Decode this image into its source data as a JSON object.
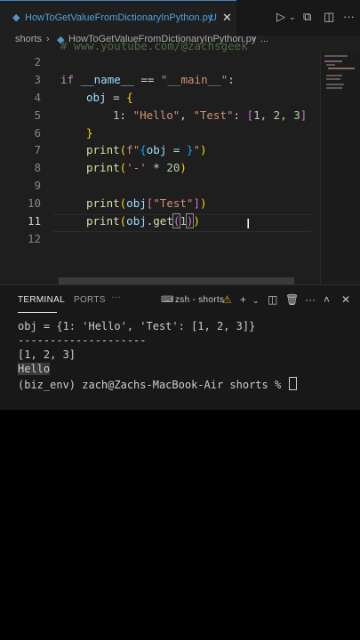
{
  "tab": {
    "filename": "HowToGetValueFromDictionaryInPython.py",
    "status": "U",
    "close": "✕"
  },
  "breadcrumb": {
    "folder": "shorts",
    "file": "HowToGetValueFromDictionaryInPython.py",
    "more": "..."
  },
  "editor": {
    "top_comment": "# www.youtube.com/@zachsgeek",
    "lines": [
      {
        "number": "2"
      },
      {
        "number": "3",
        "p1": "if",
        "p2": " __name__ ",
        "p3": "==",
        "p4": " \"__main__\"",
        "p5": ":"
      },
      {
        "number": "4",
        "p1": "obj",
        "p2": " = ",
        "p3": "{"
      },
      {
        "number": "5",
        "p1": "1",
        "p2": ": ",
        "p3": "\"Hello\"",
        "p4": ", ",
        "p5": "\"Test\"",
        "p6": ": ",
        "p7": "[",
        "p8": "1, 2, 3",
        "p9": "]"
      },
      {
        "number": "6",
        "p1": "}"
      },
      {
        "number": "7",
        "p1": "print",
        "p2": "(",
        "p3": "f\"",
        "p4": "{",
        "p5": "obj = ",
        "p6": "}",
        "p7": "\"",
        "p8": ")"
      },
      {
        "number": "8",
        "p1": "print",
        "p2": "(",
        "p3": "'-'",
        "p4": " * ",
        "p5": "20",
        "p6": ")"
      },
      {
        "number": "9"
      },
      {
        "number": "10",
        "p1": "print",
        "p2": "(",
        "p3": "obj",
        "p4": "[",
        "p5": "\"Test\"",
        "p6": "]",
        "p7": ")"
      },
      {
        "number": "11",
        "p1": "print",
        "p2": "(",
        "p3": "obj.",
        "p4": "get",
        "p5": "(",
        "p6": "1",
        "p7": ")",
        "p8": ")"
      },
      {
        "number": "12"
      }
    ]
  },
  "panel": {
    "tabs": [
      "TERMINAL",
      "PORTS"
    ],
    "more": "···",
    "shell_label": "zsh - shorts",
    "output": [
      "obj = {1: 'Hello', 'Test': [1, 2, 3]}",
      "--------------------",
      "[1, 2, 3]",
      "Hello"
    ],
    "prompt": "(biz_env) zach@Zachs-MacBook-Air shorts % "
  },
  "icons": [
    "python-file-icon",
    "run-icon",
    "split-editor-icon",
    "more-icon",
    "terminal-icon",
    "warning-icon",
    "add-terminal-icon",
    "trash-icon",
    "chevron-up-icon",
    "close-icon"
  ]
}
